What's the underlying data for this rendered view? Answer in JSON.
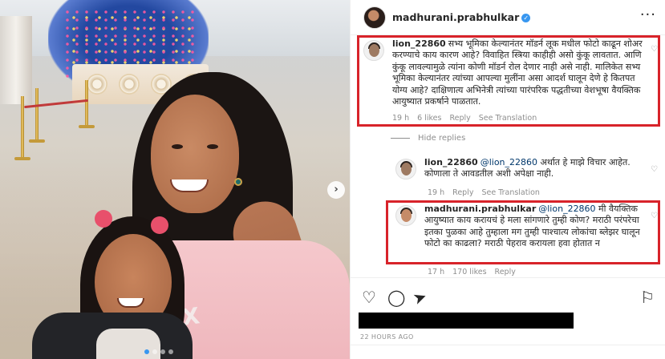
{
  "photo": {
    "shirt_print": "SX",
    "next_icon": "chevron-right-icon",
    "carousel_dots": 4,
    "carousel_active_index": 0
  },
  "header": {
    "username": "madhurani.prabhulkar",
    "verified_icon": "verified-badge-icon",
    "more_icon": "ellipsis-icon"
  },
  "comments": [
    {
      "username": "lion_22860",
      "text": "सभ्य भूमिका केल्यानंतर मॉडर्न लूक मधील फोटो काढून शोअर करण्याचे काय कारण आहे? विवाहित स्त्रिया काहीही असो कुंकू लावतात. आणि कुंकू लावल्यामुळे त्यांना कोणी मॉडर्न रोल देणार नाही असे नाही. मालिकेत सभ्य भूमिका केल्यानंतर त्यांच्या आपल्या मुलींना असा आदर्श घालून देणे हे कितपत योग्य आहे? दाक्षिणात्य अभिनेत्री त्यांच्या पारंपरिक पद्धतीच्या वेशभूषा वैयक्तिक आयुष्यात प्रकर्षाने पाळतात.",
      "time": "19 h",
      "likes": "6 likes",
      "reply": "Reply",
      "see_translation": "See Translation"
    }
  ],
  "hide_replies": "Hide replies",
  "replies": [
    {
      "username": "lion_22860",
      "mention": "@lion_22860",
      "text": " अर्थात हे माझे विचार आहेत. कोणाला ते आवडतील अशी अपेक्षा नाही.",
      "time": "19 h",
      "reply": "Reply",
      "see_translation": "See Translation"
    },
    {
      "username": "madhurani.prabhulkar",
      "mention": "@lion_22860",
      "text": " मी वैयक्तिक आयुष्यात काय करायचं हे मला सांगणारे तुम्ही कोण? मराठी परंपरेचा इतका पुळका आहे तुम्हाला मग तुम्ही पाश्चात्य लोकांचा ब्लेझर घालून फोटो का काढला? मराठी पेहराव करायला हवा होतात न",
      "time": "17 h",
      "likes": "170 likes",
      "reply": "Reply"
    }
  ],
  "actions": {
    "like_icon": "heart-icon",
    "comment_icon": "comment-icon",
    "share_icon": "paper-plane-icon",
    "save_icon": "bookmark-icon"
  },
  "post_time": "22 HOURS AGO",
  "colors": {
    "highlight": "#d8232a",
    "mention": "#00376b",
    "verified": "#3897f0",
    "meta": "#8e8e8e"
  }
}
